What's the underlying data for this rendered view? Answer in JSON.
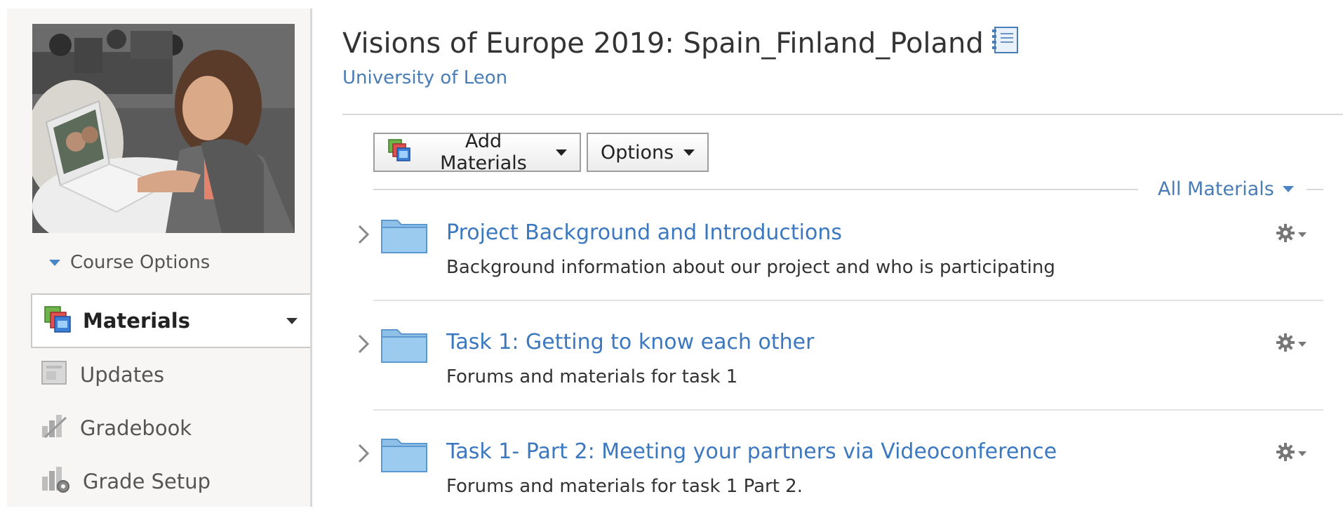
{
  "sidebar": {
    "course_options_label": "Course Options",
    "active_item": {
      "label": "Materials",
      "icon": "materials-icon"
    },
    "items": [
      {
        "label": "Updates",
        "icon": "updates-icon"
      },
      {
        "label": "Gradebook",
        "icon": "gradebook-icon"
      },
      {
        "label": "Grade Setup",
        "icon": "grade-setup-icon"
      }
    ]
  },
  "course": {
    "title": "Visions of Europe 2019: Spain_Finland_Poland",
    "school": "University of Leon"
  },
  "toolbar": {
    "add_materials_label": "Add Materials",
    "options_label": "Options",
    "filter_label": "All Materials"
  },
  "materials": [
    {
      "title": "Project Background and Introductions",
      "description": "Background information about our project and who is participating"
    },
    {
      "title": "Task 1: Getting to know each other",
      "description": "Forums and materials for task 1"
    },
    {
      "title": "Task 1- Part 2: Meeting your partners via Videoconference",
      "description": "Forums and materials for task 1 Part 2."
    }
  ],
  "colors": {
    "link": "#3b78bf",
    "accent": "#4a86c6",
    "folder": "#8fc0e8"
  }
}
